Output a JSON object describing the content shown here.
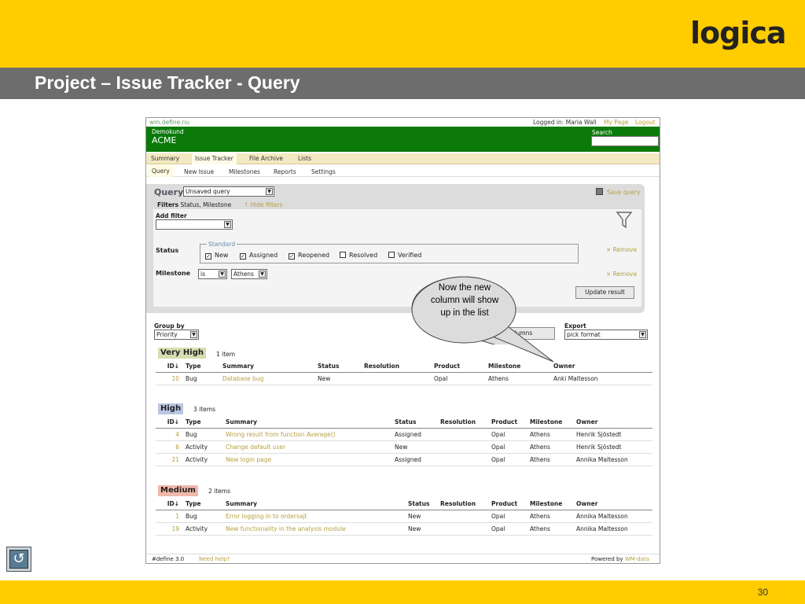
{
  "slide": {
    "title": "Project – Issue Tracker - Query",
    "logo": "logica",
    "page_number": "30",
    "brand_color": "#FFCC00",
    "title_bar_color": "#6d6d6d",
    "nav_icon": "return-arrow-icon"
  },
  "app": {
    "site_url": "wm.define.nu",
    "logged_in": "Logged in: Maria Wall",
    "my_page": "My Page",
    "logout": "Logout",
    "customer": "Demokund",
    "company": "ACME",
    "search_label": "Search",
    "header_color": "#0b7a0b",
    "main_tabs": [
      "Summary",
      "Issue Tracker",
      "File Archive",
      "Lists"
    ],
    "sub_tabs": [
      "Query",
      "New Issue",
      "Milestones",
      "Reports",
      "Settings"
    ],
    "query": {
      "label": "Query",
      "selected": "Unsaved query",
      "save_query": "Save query",
      "filters_label": "Filters",
      "filters_value": "Status, Milestone",
      "hide_filters": "↑ Hide filters",
      "add_filter": "Add filter",
      "status_label": "Status",
      "standard_legend": "Standard",
      "statuses": [
        {
          "label": "New",
          "checked": true
        },
        {
          "label": "Assigned",
          "checked": true
        },
        {
          "label": "Reopened",
          "checked": true
        },
        {
          "label": "Resolved",
          "checked": false
        },
        {
          "label": "Verified",
          "checked": false
        }
      ],
      "remove_label": "× Remove",
      "milestone_label": "Milestone",
      "milestone_op": "is",
      "milestone_value": "Athens",
      "update_result": "Update result"
    },
    "group_by_label": "Group by",
    "group_by_value": "Priority",
    "columns_button": "Columns",
    "export_label": "Export",
    "export_value": "pick format",
    "groups": [
      {
        "name": "Very High",
        "count": "1 item",
        "color": "#d6deb0",
        "columns": [
          "ID↓",
          "Type",
          "Summary",
          "Status",
          "Resolution",
          "Product",
          "Milestone",
          "Owner"
        ],
        "rows": [
          [
            "10",
            "Bug",
            "Database bug",
            "New",
            "",
            "Opal",
            "Athens",
            "Anki Maltesson"
          ]
        ]
      },
      {
        "name": "High",
        "count": "3 items",
        "color": "#b9c6e0",
        "columns": [
          "ID↓",
          "Type",
          "Summary",
          "Status",
          "Resolution",
          "Product",
          "Milestone",
          "Owner"
        ],
        "rows": [
          [
            "4",
            "Bug",
            "Wrong result from function Average()",
            "Assigned",
            "",
            "Opal",
            "Athens",
            "Henrik Sjöstedt"
          ],
          [
            "6",
            "Activity",
            "Change default user",
            "New",
            "",
            "Opal",
            "Athens",
            "Henrik Sjöstedt"
          ],
          [
            "21",
            "Activity",
            "New login page",
            "Assigned",
            "",
            "Opal",
            "Athens",
            "Annika Maltesson"
          ]
        ]
      },
      {
        "name": "Medium",
        "count": "2 items",
        "color": "#f2b8ac",
        "columns": [
          "ID↓",
          "Type",
          "Summary",
          "Status",
          "Resolution",
          "Product",
          "Milestone",
          "Owner"
        ],
        "rows": [
          [
            "1",
            "Bug",
            "Error logging in to ordersajt",
            "New",
            "",
            "Opal",
            "Athens",
            "Annika Maltesson"
          ],
          [
            "19",
            "Activity",
            "New functionality in the analysis module",
            "New",
            "",
            "Opal",
            "Athens",
            "Annika Maltesson"
          ]
        ]
      }
    ],
    "footer": {
      "version": "#define 3.0",
      "help": "Need help?",
      "powered_by": "Powered by",
      "powered_brand": "WM-data"
    }
  },
  "callout": {
    "text": "Now the new column will show up in the list"
  }
}
